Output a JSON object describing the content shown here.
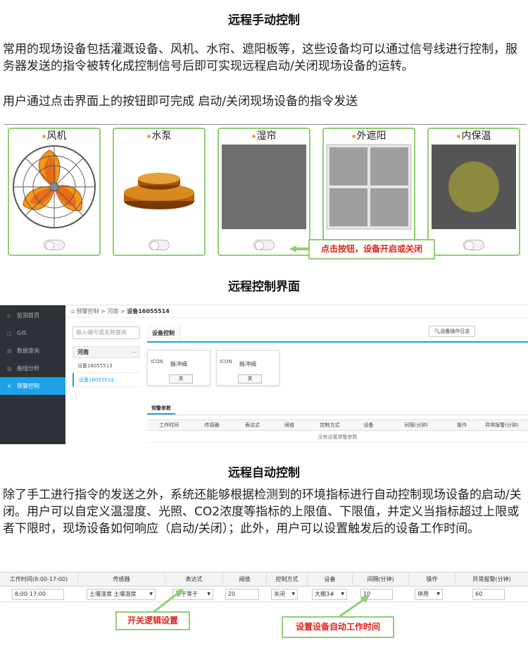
{
  "section1": {
    "title": "远程手动控制",
    "para1": "  常用的现场设备包括灌溉设备、风机、水帘、遮阳板等，这些设备均可以通过信号线进行控制，服务器发送的指令被转化成控制信号后即可实现远程启动/关闭现场设备的运转。",
    "para2": "用户通过点击界面上的按钮即可完成 启动/关闭现场设备的指令发送",
    "devices": [
      {
        "label": "风机"
      },
      {
        "label": "水泵"
      },
      {
        "label": "湿帘"
      },
      {
        "label": "外遮阳"
      },
      {
        "label": "内保温"
      }
    ],
    "callout": "点击按钮，设备开启或关闭",
    "colors": {
      "card_border": "#8fcf72",
      "callout_text": "#e0241b"
    }
  },
  "section2": {
    "title": "远程控制界面",
    "sidebar": [
      {
        "icon": "home-icon",
        "glyph": "⌂",
        "label": "监测首页"
      },
      {
        "icon": "gis-icon",
        "glyph": "◫",
        "label": "GIS"
      },
      {
        "icon": "database-icon",
        "glyph": "▤",
        "label": "数据查询"
      },
      {
        "icon": "chart-icon",
        "glyph": "▥",
        "label": "曲线分析"
      },
      {
        "icon": "control-icon",
        "glyph": "✕",
        "label": "预警控制"
      }
    ],
    "breadcrumb": {
      "home": "预警控制",
      "sep": ">",
      "region": "河南",
      "device": "设备16055514"
    },
    "search_placeholder": "输入编号或名称查询",
    "tree": {
      "group": "河南",
      "collapse": "—",
      "items": [
        "设备16055513",
        "设备16055514"
      ]
    },
    "tab_label": "设备控制",
    "log_button": "设备操作日志",
    "valves": [
      {
        "icon": "valve-icon",
        "icon_text": "ICON",
        "label": "脉冲阀",
        "button": "关"
      },
      {
        "icon": "valve-icon",
        "icon_text": "ICON",
        "label": "脉冲阀",
        "button": "关"
      }
    ],
    "alarm_tab": "预警参数",
    "alarm_columns": [
      "工作时间",
      "传感器",
      "表达式",
      "阀值",
      "控制方式",
      "设备",
      "间隔(分钟)",
      "操作",
      "异常报警(分钟)"
    ],
    "alarm_empty": "没有设置预警参数",
    "colors": {
      "sidebar_bg": "#2e3238",
      "accent": "#1da1e8"
    }
  },
  "section3": {
    "title": "远程自动控制",
    "para": "  除了手工进行指令的发送之外，系统还能够根据检测到的环境指标进行自动控制现场设备的启动/关闭。用户可以自定义温湿度、光照、CO2浓度等指标的上限值、下限值，并定义当指标超过上限或者下限时，现场设备如何响应（启动/关闭）；此外，用户可以设置触发后的设备工作时间。",
    "columns": [
      "工作时间(8:00-17:00)",
      "传感器",
      "表达式",
      "阀值",
      "控制方式",
      "设备",
      "间隔(分钟)",
      "操作",
      "异常报警(分钟)"
    ],
    "row": {
      "time": "8:00-17:00",
      "sensor": "土壤湿度 土壤湿度",
      "expr": "小于等于",
      "threshold": "20",
      "mode": "关闭",
      "device": "大棚3#",
      "interval": "10",
      "op": "停用",
      "alarm": "60"
    },
    "callout_logic": "开关逻辑设置",
    "callout_time": "设置设备自动工作时间"
  }
}
